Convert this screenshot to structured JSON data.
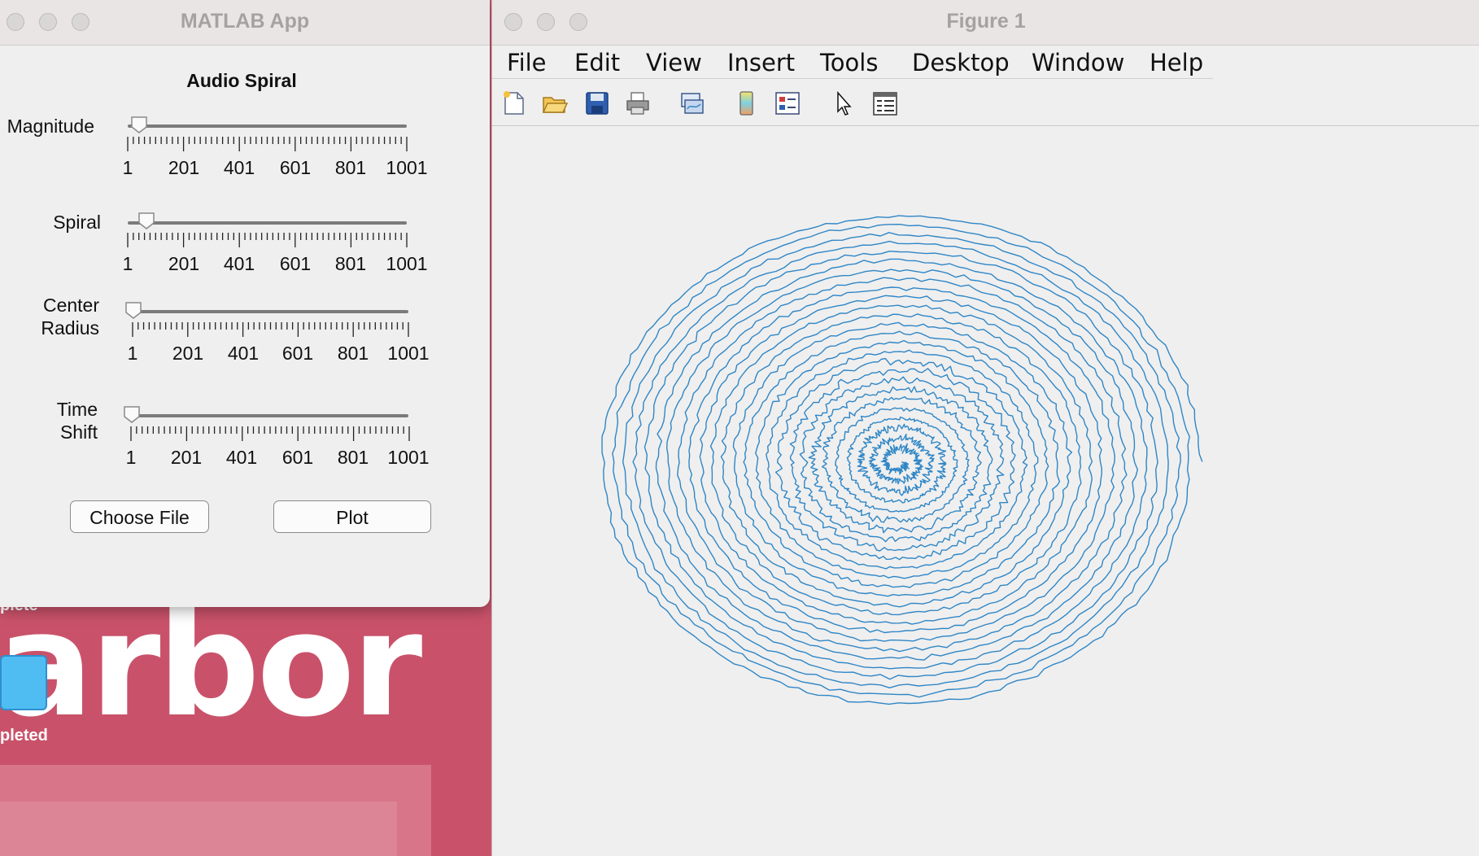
{
  "background_app": {
    "word": "arbor",
    "top_text": "plete",
    "bottom_text": "pleted"
  },
  "matlab_app": {
    "title": "MATLAB App",
    "heading": "Audio Spiral",
    "sliders": [
      {
        "label": "Magnitude",
        "value": 21,
        "min": 1,
        "max": 1001,
        "ticks": [
          "1",
          "201",
          "401",
          "601",
          "801",
          "1001"
        ]
      },
      {
        "label": "Spiral",
        "value": 41,
        "min": 1,
        "max": 1001,
        "ticks": [
          "1",
          "201",
          "401",
          "601",
          "801",
          "1001"
        ]
      },
      {
        "label_lines": [
          "Center",
          "Radius"
        ],
        "value": 1,
        "min": 1,
        "max": 1001,
        "ticks": [
          "1",
          "201",
          "401",
          "601",
          "801",
          "1001"
        ]
      },
      {
        "label_lines": [
          "Time",
          "Shift"
        ],
        "value": 1,
        "min": 1,
        "max": 1001,
        "ticks": [
          "1",
          "201",
          "401",
          "601",
          "801",
          "1001"
        ]
      }
    ],
    "buttons": {
      "choose_file": "Choose File",
      "plot": "Plot"
    }
  },
  "figure": {
    "title": "Figure 1",
    "menu": [
      "File",
      "Edit",
      "View",
      "Insert",
      "Tools",
      "Desktop",
      "Window",
      "Help"
    ],
    "toolbar_icons": [
      "new-figure-icon",
      "open-file-icon",
      "save-icon",
      "print-icon",
      "link-plot-icon",
      "colorbar-icon",
      "legend-icon",
      "edit-plot-icon",
      "property-inspector-icon"
    ],
    "plot": {
      "type": "audio spiral line plot",
      "line_color": "#2f86c6"
    }
  }
}
